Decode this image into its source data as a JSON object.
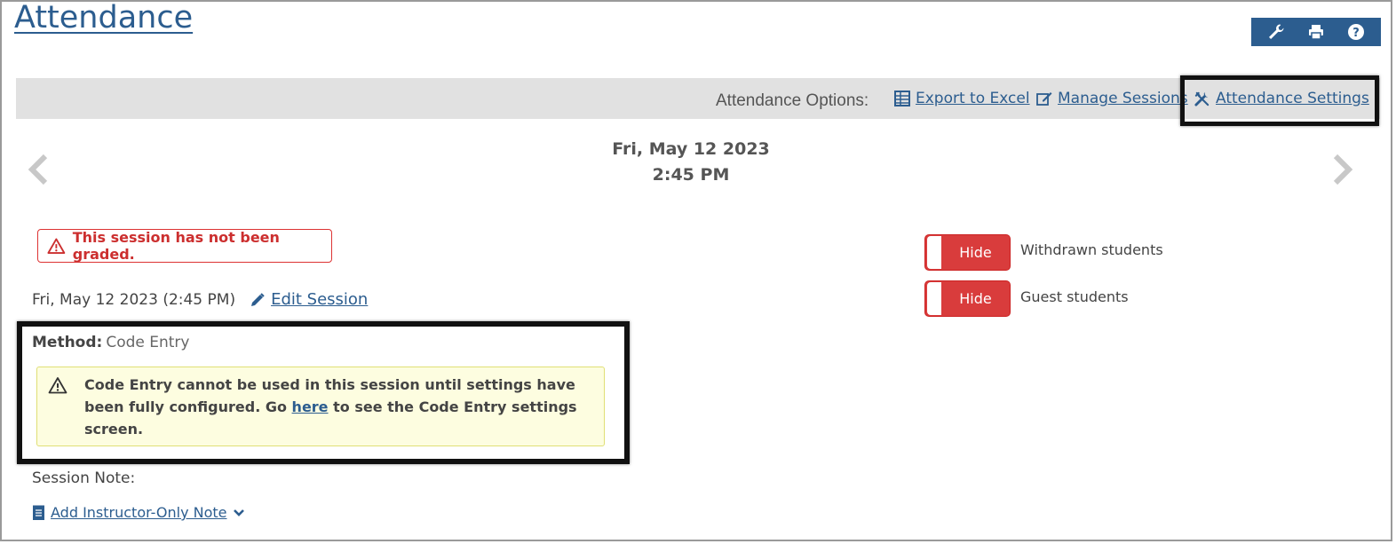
{
  "page": {
    "title": "Attendance"
  },
  "colors": {
    "accent": "#2c5d8f",
    "danger": "#d93c3c",
    "warn_bg": "#fdfde0",
    "options_bg": "#e1e1e1"
  },
  "toolbar": {
    "icons": [
      "wrench-icon",
      "print-icon",
      "help-icon"
    ]
  },
  "options": {
    "label": "Attendance Options:",
    "export": "Export to Excel",
    "manage": "Manage Sessions",
    "settings": "Attendance Settings"
  },
  "session": {
    "date": "Fri, May 12 2023",
    "time": "2:45 PM",
    "alert": "This session has not been graded.",
    "summary": "Fri, May 12 2023 (2:45 PM)",
    "edit": "Edit Session",
    "method_label": "Method:",
    "method_value": "Code Entry",
    "warning_pre": "Code Entry cannot be used in this session until settings have been fully configured. Go ",
    "warning_link": "here",
    "warning_post": " to see the Code Entry settings screen.",
    "note_label": "Session Note:",
    "add_note": "Add Instructor-Only Note"
  },
  "toggles": [
    {
      "state": "Hide",
      "label": "Withdrawn students"
    },
    {
      "state": "Hide",
      "label": "Guest students"
    }
  ]
}
